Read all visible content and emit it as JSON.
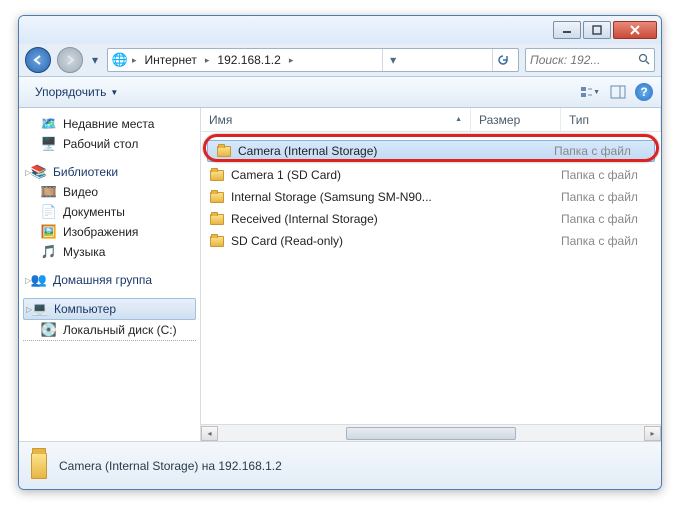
{
  "breadcrumb": {
    "seg1": "Интернет",
    "seg2": "192.168.1.2"
  },
  "search": {
    "placeholder": "Поиск: 192..."
  },
  "toolbar": {
    "organize": "Упорядочить"
  },
  "tree": {
    "recent": "Недавние места",
    "desktop": "Рабочий стол",
    "libraries": "Библиотеки",
    "video": "Видео",
    "documents": "Документы",
    "pictures": "Изображения",
    "music": "Музыка",
    "homegroup": "Домашняя группа",
    "computer": "Компьютер",
    "localdisk": "Локальный диск (C:)"
  },
  "columns": {
    "name": "Имя",
    "size": "Размер",
    "type": "Тип"
  },
  "rows": [
    {
      "name": "Camera (Internal Storage)",
      "type": "Папка с файл",
      "selected": true
    },
    {
      "name": "Camera 1 (SD Card)",
      "type": "Папка с файл",
      "selected": false
    },
    {
      "name": "Internal Storage (Samsung SM-N90...",
      "type": "Папка с файл",
      "selected": false
    },
    {
      "name": "Received (Internal Storage)",
      "type": "Папка с файл",
      "selected": false
    },
    {
      "name": "SD Card (Read-only)",
      "type": "Папка с файл",
      "selected": false
    }
  ],
  "status": {
    "text": "Camera (Internal Storage) на 192.168.1.2"
  },
  "icons": {
    "globe": "🌐",
    "recent": "🗺️",
    "desktop": "🖥️",
    "lib": "📚",
    "video": "🎞️",
    "doc": "📄",
    "pic": "🖼️",
    "music": "🎵",
    "homegroup": "👥",
    "computer": "💻",
    "disk": "💽"
  }
}
